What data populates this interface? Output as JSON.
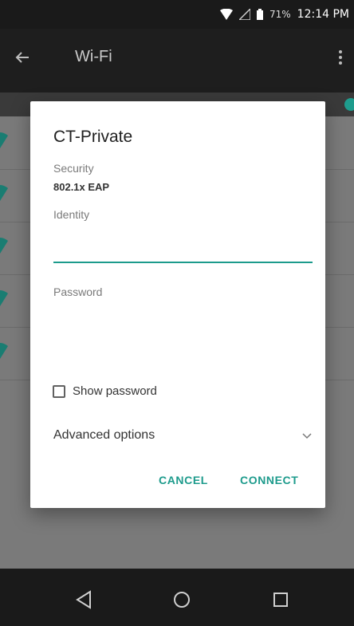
{
  "status_bar": {
    "battery_percent": "71%",
    "time": "12:14 PM",
    "icons": [
      "wifi-icon",
      "signal-icon",
      "battery-icon"
    ]
  },
  "app_bar": {
    "title": "Wi-Fi",
    "icons": [
      "back-arrow-icon",
      "more-vert-icon"
    ]
  },
  "dialog": {
    "title": "CT-Private",
    "security_label": "Security",
    "security_value": "802.1x EAP",
    "identity_label": "Identity",
    "identity_value": "",
    "password_label": "Password",
    "password_value": "",
    "show_password_label": "Show password",
    "show_password_checked": false,
    "advanced_label": "Advanced options",
    "cancel_label": "CANCEL",
    "connect_label": "CONNECT"
  },
  "colors": {
    "accent": "#1d9b8c",
    "status_bar": "#1a1a1a",
    "app_bar": "#1e1e1e",
    "dim_background": "#7a7a7a",
    "dialog_bg": "#ffffff"
  },
  "nav_bar": {
    "icons": [
      "back-triangle-icon",
      "home-circle-icon",
      "recents-square-icon"
    ]
  }
}
